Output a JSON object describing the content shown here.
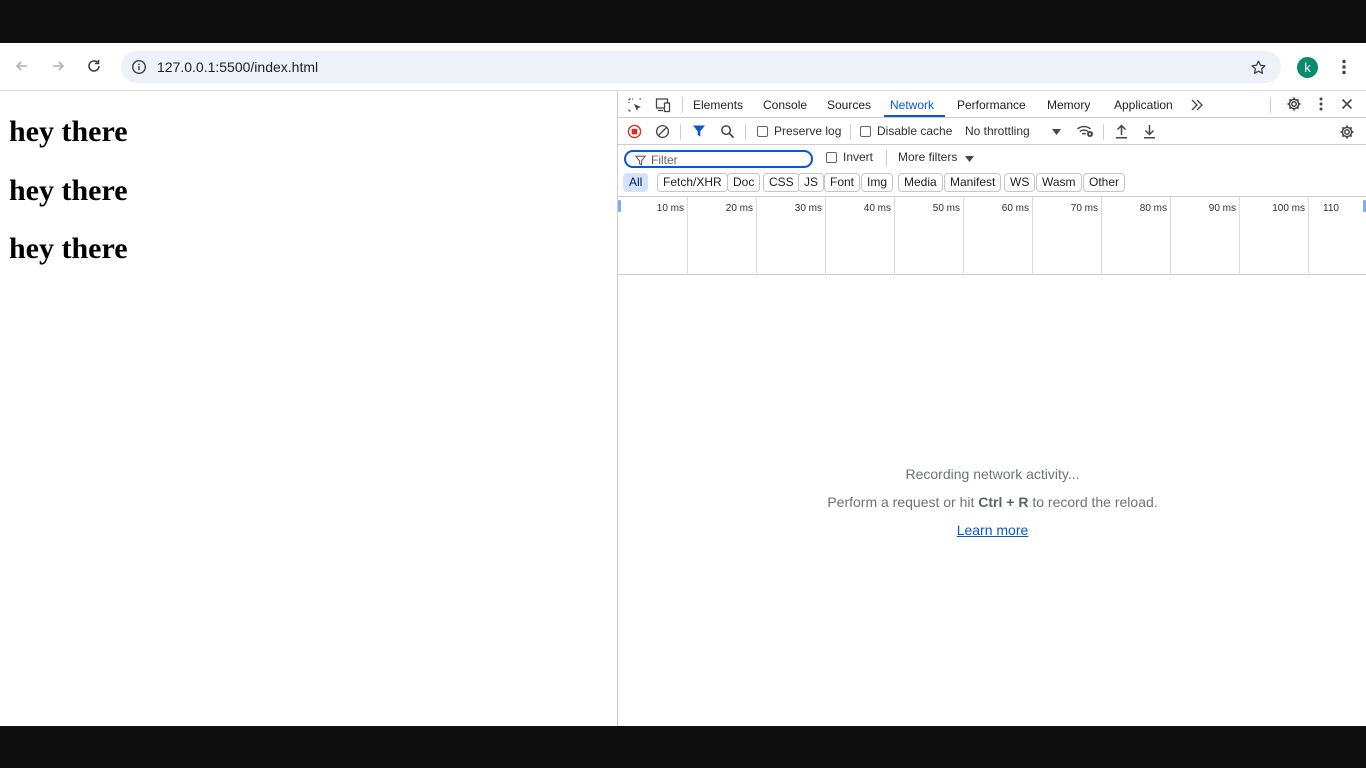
{
  "browser": {
    "url": "127.0.0.1:5500/index.html",
    "avatar_letter": "k"
  },
  "page": {
    "headings": [
      "hey there",
      "hey there",
      "hey there"
    ]
  },
  "devtools": {
    "tabs": [
      "Elements",
      "Console",
      "Sources",
      "Network",
      "Performance",
      "Memory",
      "Application"
    ],
    "active_tab": "Network",
    "toolbar": {
      "preserve_log": "Preserve log",
      "disable_cache": "Disable cache",
      "throttling": "No throttling"
    },
    "filter": {
      "placeholder": "Filter",
      "invert": "Invert",
      "more_filters": "More filters"
    },
    "type_filters": [
      "All",
      "Fetch/XHR",
      "Doc",
      "CSS",
      "JS",
      "Font",
      "Img",
      "Media",
      "Manifest",
      "WS",
      "Wasm",
      "Other"
    ],
    "active_type_filter": "All",
    "timeline_ticks": [
      "10 ms",
      "20 ms",
      "30 ms",
      "40 ms",
      "50 ms",
      "60 ms",
      "70 ms",
      "80 ms",
      "90 ms",
      "100 ms",
      "110"
    ],
    "empty_state": {
      "title": "Recording network activity...",
      "hint_prefix": "Perform a request or hit ",
      "hint_keys": "Ctrl + R",
      "hint_suffix": " to record the reload.",
      "learn_more": "Learn more"
    }
  },
  "colors": {
    "accent": "#0b57d0",
    "avatar": "#0b8a6e",
    "record": "#d93025"
  }
}
